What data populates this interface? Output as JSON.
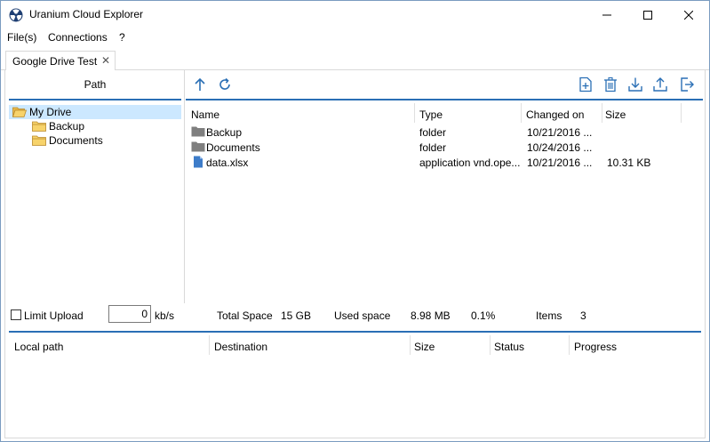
{
  "window": {
    "title": "Uranium Cloud Explorer",
    "controls": [
      "minimize",
      "maximize",
      "close"
    ]
  },
  "menu": [
    "File(s)",
    "Connections",
    "?"
  ],
  "tabs": [
    {
      "label": "Google Drive Test",
      "close": "✕"
    }
  ],
  "tree": {
    "header": "Path",
    "items": [
      {
        "label": "My Drive",
        "selected": true,
        "icon": "folder-open-icon"
      },
      {
        "label": "Backup",
        "icon": "folder-icon"
      },
      {
        "label": "Documents",
        "icon": "folder-icon"
      }
    ]
  },
  "toolbar": {
    "icons": [
      "up-arrow-icon",
      "refresh-icon",
      "new-file-icon",
      "trash-icon",
      "download-icon",
      "upload-icon",
      "exit-icon"
    ]
  },
  "files": {
    "columns": [
      "Name",
      "Type",
      "Changed on",
      "Size"
    ],
    "rows": [
      {
        "name": "Backup",
        "type": "folder",
        "changed": "10/21/2016 ...",
        "size": "",
        "icon": "folder-gray-icon"
      },
      {
        "name": "Documents",
        "type": "folder",
        "changed": "10/24/2016 ...",
        "size": "",
        "icon": "folder-gray-icon"
      },
      {
        "name": "data.xlsx",
        "type": "application vnd.ope...",
        "changed": "10/21/2016 ...",
        "size": "10.31 KB",
        "icon": "document-icon"
      }
    ]
  },
  "status": {
    "limit_upload_label": "Limit Upload",
    "limit_checked": false,
    "rate_value": "0",
    "rate_unit": "kb/s",
    "total_space_label": "Total Space",
    "total_space_value": "15 GB",
    "used_space_label": "Used space",
    "used_space_value": "8.98 MB",
    "used_percent": "0.1%",
    "items_label": "Items",
    "items_value": "3"
  },
  "queue": {
    "columns": [
      "Local path",
      "Destination",
      "Size",
      "Status",
      "Progress"
    ]
  },
  "colors": {
    "accent": "#2a6fb5",
    "selection": "#cce8ff",
    "folder_yellow": "#f7d36b",
    "folder_gray": "#7f7f7f",
    "doc_blue": "#3d7cc9"
  }
}
